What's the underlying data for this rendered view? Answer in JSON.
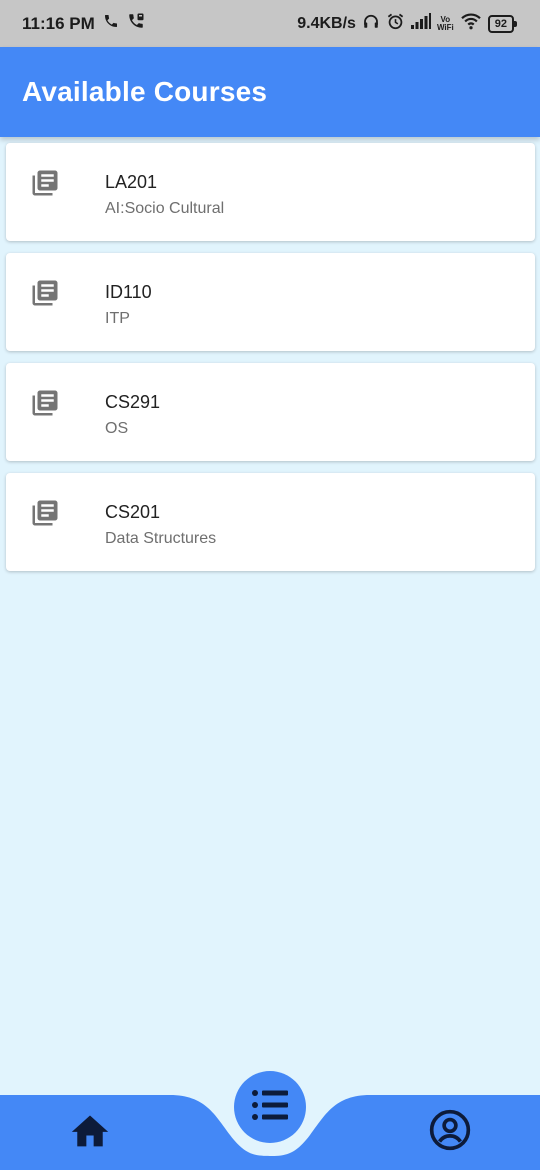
{
  "status_bar": {
    "time": "11:16 PM",
    "network_speed": "9.4KB/s",
    "vowifi_top": "Vo",
    "vowifi_bottom": "WiFi",
    "battery": "92",
    "icons": [
      "phone-icon",
      "call-forward-icon",
      "headphones-icon",
      "alarm-icon",
      "signal-icon",
      "wifi-icon",
      "battery-icon"
    ]
  },
  "app_bar": {
    "title": "Available Courses"
  },
  "courses": [
    {
      "code": "LA201",
      "name": "AI:Socio Cultural",
      "icon": "library-books-icon"
    },
    {
      "code": "ID110",
      "name": "ITP",
      "icon": "library-books-icon"
    },
    {
      "code": "CS291",
      "name": "OS",
      "icon": "library-books-icon"
    },
    {
      "code": "CS201",
      "name": "Data Structures",
      "icon": "library-books-icon"
    }
  ],
  "bottom_nav": {
    "items": [
      "home-icon",
      "list-icon",
      "account-circle-icon"
    ],
    "active": "list-icon"
  },
  "colors": {
    "primary": "#4488f6",
    "background": "#e1f4fd",
    "card": "#ffffff",
    "status_bar": "#c6c6c6",
    "nav_icon": "#0d1b3a"
  }
}
